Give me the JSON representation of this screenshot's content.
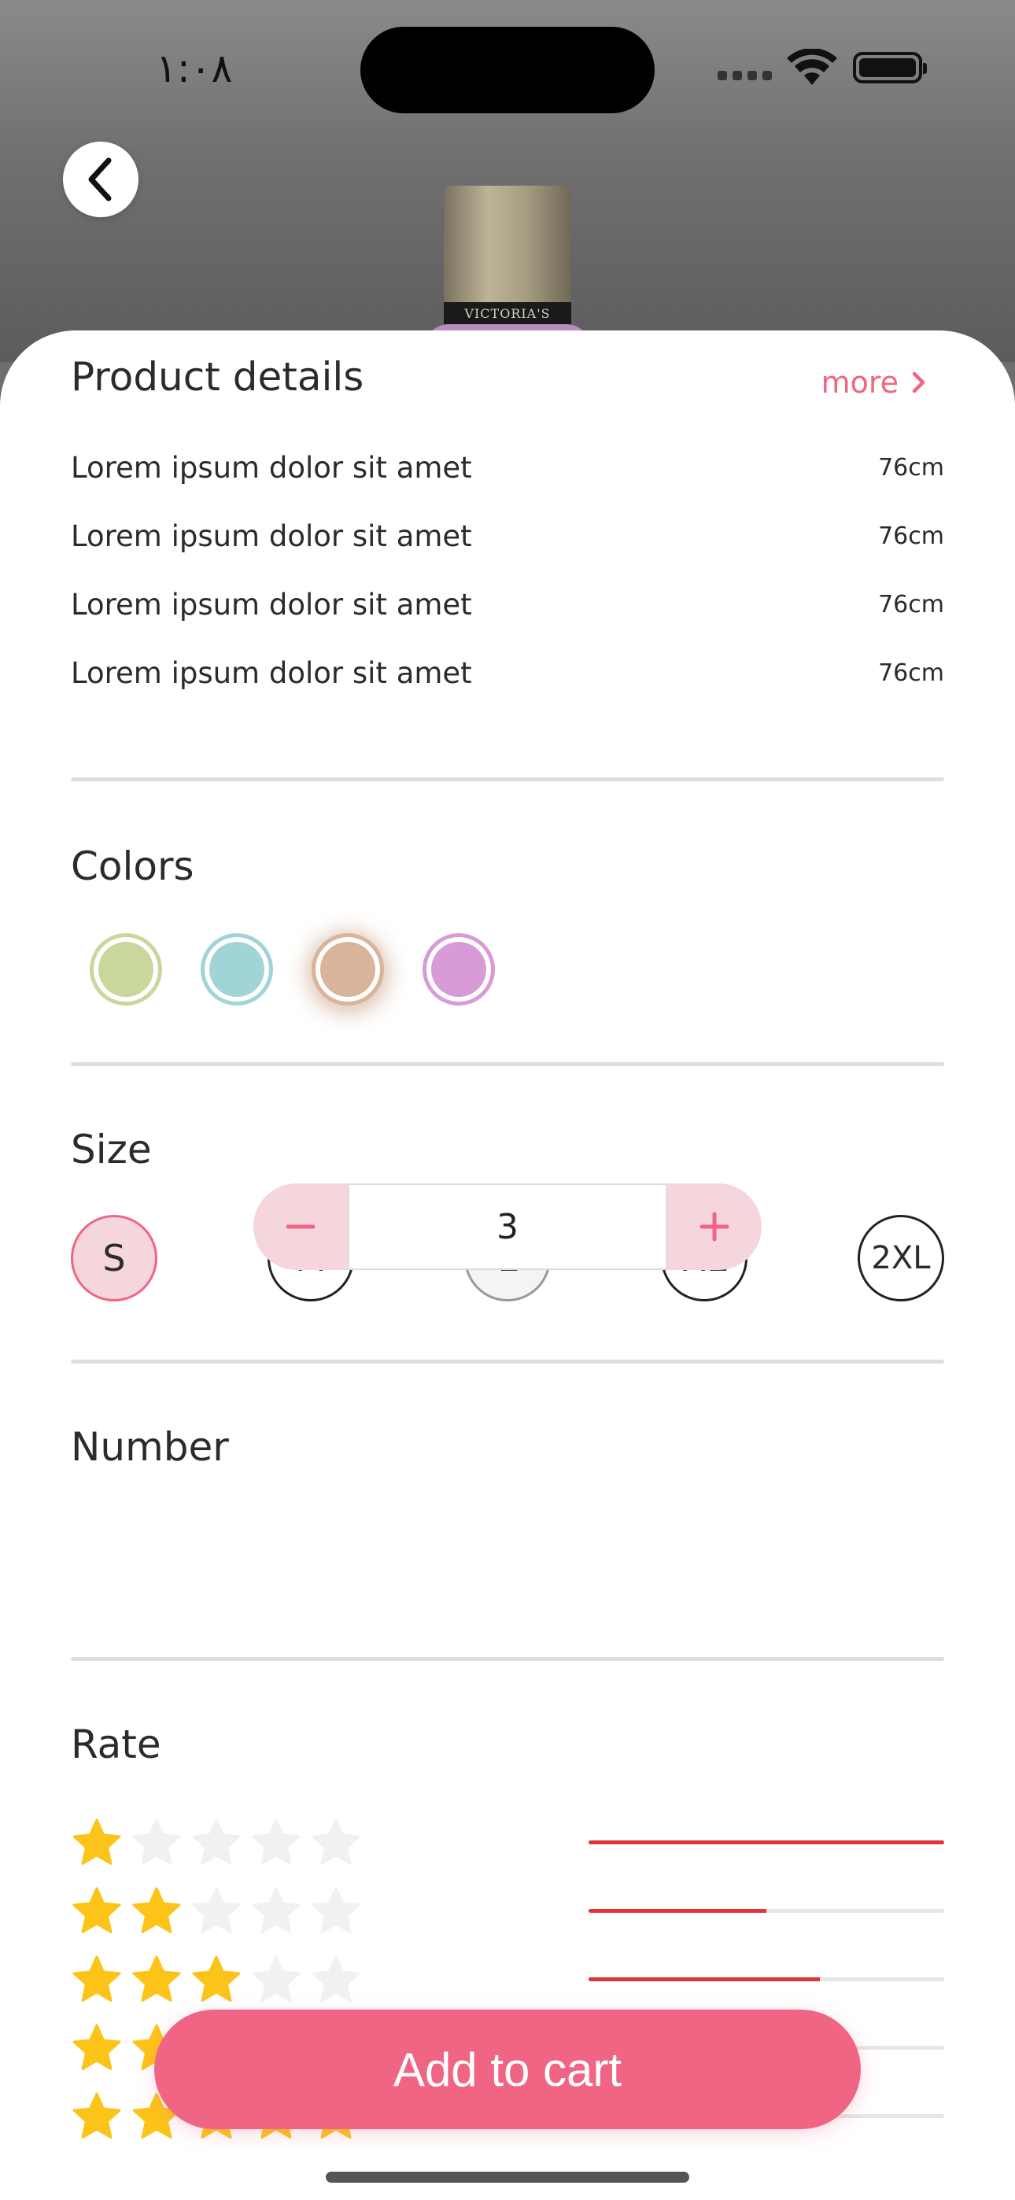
{
  "status_bar": {
    "time": "١:٠٨"
  },
  "product_image": {
    "brand_band": "VICTORIA'S SECRET"
  },
  "product_details": {
    "title": "Product details",
    "more_label": "more",
    "rows": [
      {
        "label": "Lorem ipsum dolor sit amet",
        "value": "76cm"
      },
      {
        "label": "Lorem ipsum dolor sit amet",
        "value": "76cm"
      },
      {
        "label": "Lorem ipsum dolor sit amet",
        "value": "76cm"
      },
      {
        "label": "Lorem ipsum dolor sit amet",
        "value": "76cm"
      }
    ]
  },
  "colors": {
    "title": "Colors",
    "options": [
      {
        "color": "#c9d79c",
        "ring": "#c9d79c",
        "selected": false
      },
      {
        "color": "#a0d4d6",
        "ring": "#a0d4d6",
        "selected": false
      },
      {
        "color": "#d7b49a",
        "ring": "#d7b49a",
        "selected": true
      },
      {
        "color": "#d79cd7",
        "ring": "#d79cd7",
        "selected": false
      }
    ]
  },
  "size": {
    "title": "Size",
    "options": [
      {
        "label": "S",
        "state": "active"
      },
      {
        "label": "M",
        "state": "normal"
      },
      {
        "label": "L",
        "state": "disabled"
      },
      {
        "label": "XL",
        "state": "normal"
      },
      {
        "label": "2XL",
        "state": "normal"
      }
    ]
  },
  "number": {
    "title": "Number",
    "value": "3",
    "minus_icon": "minus-icon",
    "plus_icon": "plus-icon"
  },
  "rate": {
    "title": "Rate",
    "rows": [
      {
        "stars": 1,
        "fraction": 1.0
      },
      {
        "stars": 2,
        "fraction": 0.5
      },
      {
        "stars": 3,
        "fraction": 0.65
      },
      {
        "stars": 4,
        "fraction": 0.0
      },
      {
        "stars": 5,
        "fraction": 0.0
      }
    ]
  },
  "cart": {
    "button_label": "Add to cart"
  },
  "accent_color": "#f06584"
}
